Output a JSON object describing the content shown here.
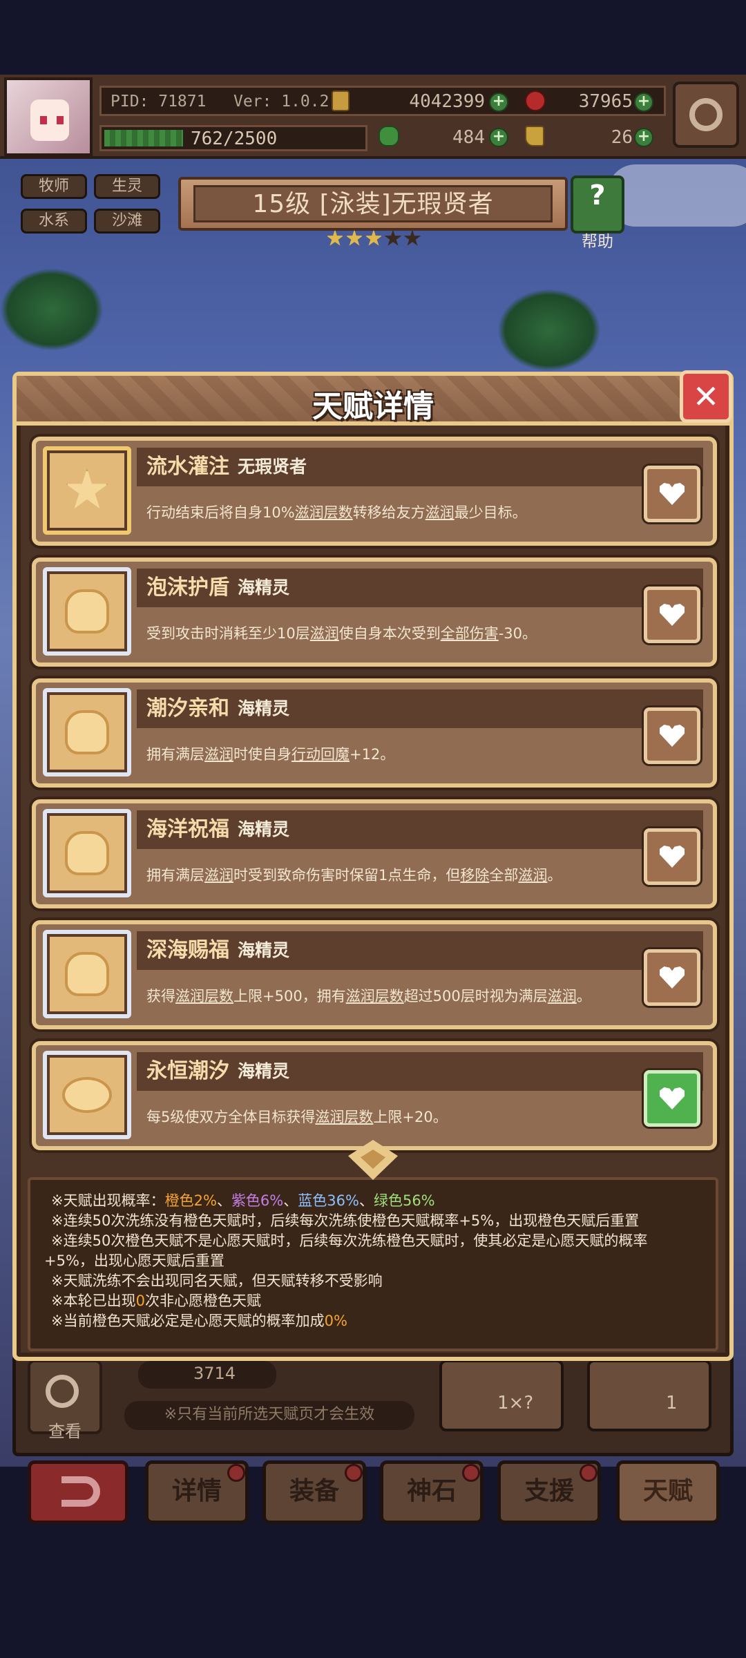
{
  "header": {
    "pid": "PID: 71871",
    "version": "Ver: 1.0.2.6",
    "gold": "4042399",
    "gems": "37965",
    "exp": "762/2500",
    "exp_fraction": 0.305,
    "clover": "484",
    "boots": "26"
  },
  "tags": [
    "牧师",
    "生灵",
    "水系",
    "沙滩"
  ],
  "character": {
    "title": "15级  [泳装]无瑕贤者",
    "stars_filled": 3,
    "stars_total": 5,
    "help_label": "帮助"
  },
  "dialog": {
    "title": "天赋详情",
    "talents": [
      {
        "name": "流水灌注",
        "source": "无瑕贤者",
        "desc_parts": [
          "行动结束后将自身10%",
          "滋润层数",
          "转移给友方",
          "滋润",
          "最少目标。"
        ],
        "wish": false,
        "icon": "star-icon"
      },
      {
        "name": "泡沫护盾",
        "source": "海精灵",
        "desc_parts": [
          "受到攻击时消耗至少10层",
          "滋润",
          "使自身本次受到",
          "全部伤害",
          "-30。"
        ],
        "wish": false,
        "icon": "hand-icon"
      },
      {
        "name": "潮汐亲和",
        "source": "海精灵",
        "desc_parts": [
          "拥有满层",
          "滋润",
          "时使自身",
          "行动回魔",
          "+12。"
        ],
        "wish": false,
        "icon": "hand-icon"
      },
      {
        "name": "海洋祝福",
        "source": "海精灵",
        "desc_parts": [
          "拥有满层",
          "滋润",
          "时受到致命伤害时保留1点生命，但",
          "移除",
          "全部",
          "滋润",
          "。"
        ],
        "wish": false,
        "icon": "hand-icon"
      },
      {
        "name": "深海赐福",
        "source": "海精灵",
        "desc_parts": [
          "获得",
          "滋润层数",
          "上限+500，拥有",
          "滋润层数",
          "超过500层时视为满层",
          "滋润",
          "。"
        ],
        "wish": false,
        "icon": "hand-icon"
      },
      {
        "name": "永恒潮汐",
        "source": "海精灵",
        "desc_parts": [
          "每5级使双方全体目标获得",
          "滋润层数",
          "上限+20。"
        ],
        "wish": true,
        "icon": "ring-icon"
      }
    ],
    "info": {
      "line1_prefix": "※天赋出现概率：",
      "orange": "橙色2%",
      "sep1": "、",
      "purple": "紫色6%",
      "sep2": "、",
      "blue": "蓝色36%",
      "sep3": "、",
      "green": "绿色56%",
      "line2": "※连续50次洗练没有橙色天赋时，后续每次洗练使橙色天赋概率+5%，出现橙色天赋后重置",
      "line3": "※连续50次橙色天赋不是心愿天赋时，后续每次洗练橙色天赋时，使其必定是心愿天赋的概率",
      "line4": "+5%，出现心愿天赋后重置",
      "line5": "※天赋洗练不会出现同名天赋，但天赋转移不受影响",
      "line6_a": "※本轮已出现",
      "line6_num": "0",
      "line6_b": "次非心愿橙色天赋",
      "line7_a": "※当前橙色天赋必定是心愿天赋的概率加成",
      "line7_num": "0%"
    }
  },
  "bottom": {
    "view_label": "查看",
    "stone_count": "3714",
    "notice": "※只有当前所选天赋页才会生效",
    "auto_cost": "1×?",
    "wash_cost": "1"
  },
  "nav": [
    "详情",
    "装备",
    "神石",
    "支援",
    "天赋"
  ],
  "colors": {
    "accent_border": "#e8c98a",
    "close": "#d94545",
    "wish_on": "#4fb24f"
  }
}
